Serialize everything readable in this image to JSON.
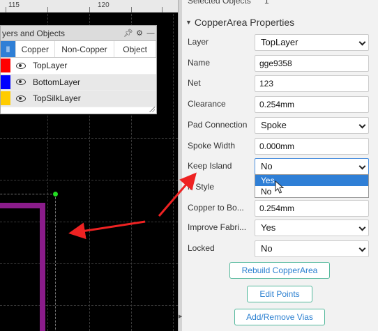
{
  "ruler": {
    "labels": [
      "115",
      "120"
    ]
  },
  "layers_panel": {
    "title": "yers and Objects",
    "tabs": [
      {
        "label": "ll",
        "active": true
      },
      {
        "label": "Copper",
        "active": false
      },
      {
        "label": "Non-Copper",
        "active": false
      },
      {
        "label": "Object",
        "active": false
      }
    ],
    "layers": [
      {
        "name": "TopLayer",
        "color": "#ff0000"
      },
      {
        "name": "BottomLayer",
        "color": "#0000ff"
      },
      {
        "name": "TopSilkLayer",
        "color": "#ffcc00"
      }
    ]
  },
  "props": {
    "selected_label": "Selected Objects",
    "selected_count": "1",
    "title": "CopperArea Properties",
    "fields": {
      "layer": {
        "label": "Layer",
        "value": "TopLayer"
      },
      "name": {
        "label": "Name",
        "value": "gge9358"
      },
      "net": {
        "label": "Net",
        "value": "123"
      },
      "clearance": {
        "label": "Clearance",
        "value": "0.254mm"
      },
      "pad_connection": {
        "label": "Pad Connection",
        "value": "Spoke"
      },
      "spoke_width": {
        "label": "Spoke Width",
        "value": "0.000mm"
      },
      "keep_island": {
        "label": "Keep Island",
        "value": "No"
      },
      "fill_style": {
        "label": "ill Style"
      },
      "copper_to_board": {
        "label": "Copper to Bo...",
        "value": "0.254mm"
      },
      "improve_fab": {
        "label": "Improve Fabri...",
        "value": "Yes"
      },
      "locked": {
        "label": "Locked",
        "value": "No"
      }
    },
    "dropdown_options": [
      "Yes",
      "No"
    ],
    "buttons": {
      "rebuild": "Rebuild CopperArea",
      "edit_points": "Edit Points",
      "add_remove_vias": "Add/Remove Vias"
    }
  },
  "colors": {
    "accent": "#2f7fd6",
    "track": "#8a1c8a",
    "arrow": "#ee2222"
  }
}
